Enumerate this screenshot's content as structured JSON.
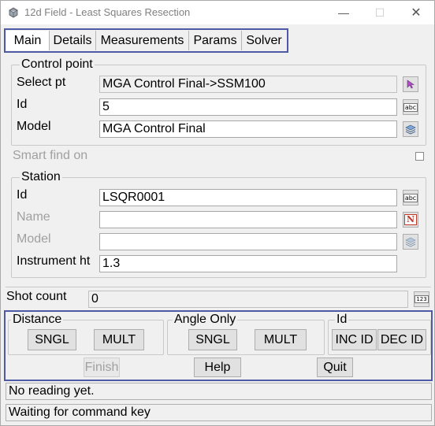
{
  "window": {
    "title": "12d Field - Least Squares Resection",
    "minimize_glyph": "—",
    "maximize_glyph": "☐",
    "close_glyph": "✕"
  },
  "tabs": [
    {
      "label": "Main"
    },
    {
      "label": "Details"
    },
    {
      "label": "Measurements"
    },
    {
      "label": "Params"
    },
    {
      "label": "Solver"
    }
  ],
  "control_point": {
    "legend": "Control point",
    "select_pt_label": "Select pt",
    "select_pt_value": "MGA Control Final->SSM100",
    "id_label": "Id",
    "id_value": "5",
    "model_label": "Model",
    "model_value": "MGA Control Final"
  },
  "smart_find": {
    "label": "Smart find on"
  },
  "station": {
    "legend": "Station",
    "id_label": "Id",
    "id_value": "LSQR0001",
    "name_label": "Name",
    "name_value": "",
    "model_label": "Model",
    "model_value": "",
    "instrument_ht_label": "Instrument ht",
    "instrument_ht_value": "1.3"
  },
  "shot_count": {
    "label": "Shot count",
    "value": "0",
    "calc_icon_text": "123"
  },
  "distance": {
    "legend": "Distance",
    "sngl": "SNGL",
    "mult": "MULT"
  },
  "angle_only": {
    "legend": "Angle Only",
    "sngl": "SNGL",
    "mult": "MULT"
  },
  "id_group": {
    "legend": "Id",
    "inc": "INC ID",
    "dec": "DEC ID"
  },
  "actions": {
    "finish": "Finish",
    "help": "Help",
    "quit": "Quit"
  },
  "status": {
    "line1": "No reading yet.",
    "line2": "Waiting for command key"
  },
  "icons": {
    "abc_text": "abc",
    "name_text": "N"
  },
  "colors": {
    "highlight_border": "#4f5aa6",
    "select_pick_icon": "#b04fc7",
    "name_icon": "#c0392b"
  }
}
